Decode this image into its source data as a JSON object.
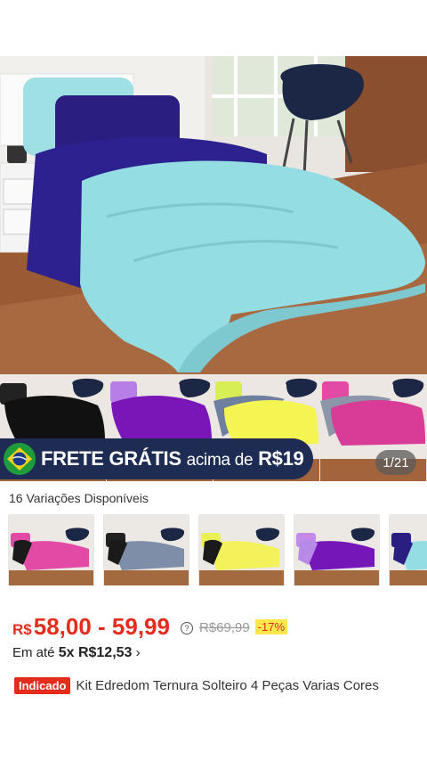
{
  "gallery": {
    "frete_bold": "FRETE GRÁTIS",
    "frete_mid": "acima de",
    "frete_value": "R$19",
    "counter": "1/21",
    "flag_icon": "brazil-flag-icon"
  },
  "variations": {
    "label": "16 Variações Disponíveis"
  },
  "price": {
    "currency": "R$",
    "range": "58,00 - 59,99",
    "old_price": "R$69,99",
    "discount": "-17%",
    "accent": "#e42c1c"
  },
  "installment": {
    "prefix": "Em até",
    "value": "5x R$12,53",
    "arrow": "›"
  },
  "product": {
    "badge": "Indicado",
    "title": "Kit Edredom Ternura Solteiro 4 Peças Varias Cores"
  }
}
